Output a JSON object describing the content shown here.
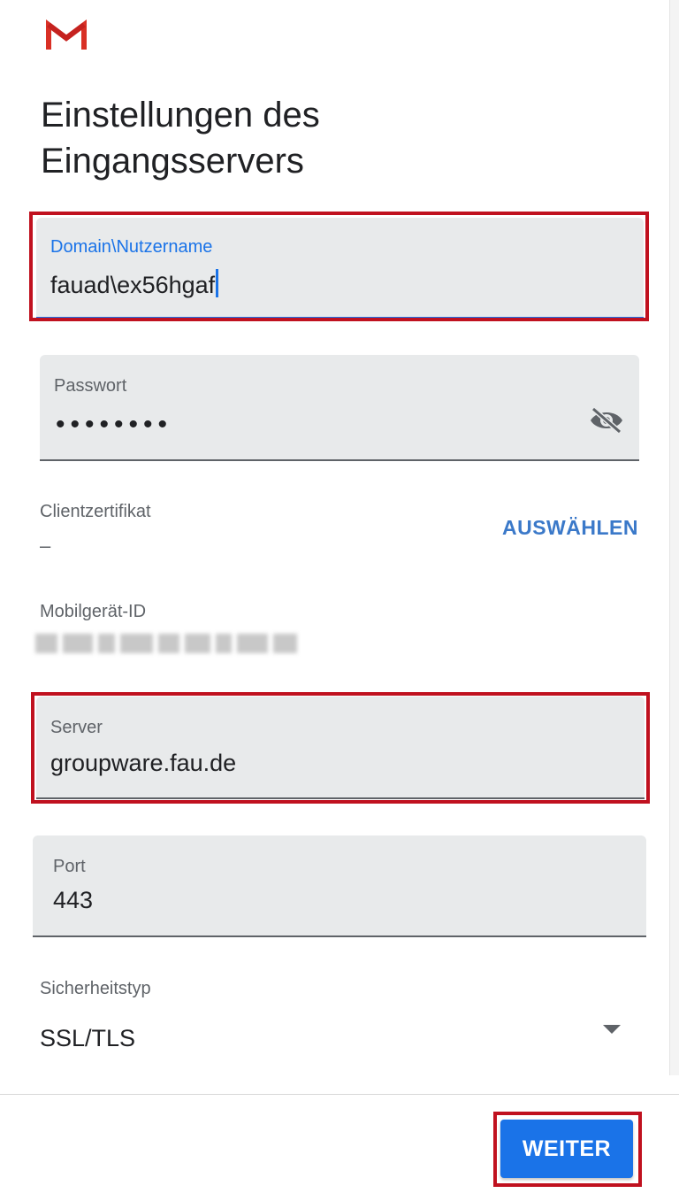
{
  "app": {
    "logo_icon": "gmail-logo-icon",
    "title_line1": "Einstellungen des",
    "title_line2": "Eingangsservers"
  },
  "fields": {
    "username": {
      "label": "Domain\\Nutzername",
      "value": "fauad\\ex56hgaf",
      "focused": true
    },
    "password": {
      "label": "Passwort",
      "masked_value": "••••••••",
      "toggle_icon": "visibility-off-icon"
    },
    "client_certificate": {
      "label": "Clientzertifikat",
      "value": "–",
      "action_label": "AUSWÄHLEN"
    },
    "device_id": {
      "label": "Mobilgerät-ID"
    },
    "server": {
      "label": "Server",
      "value": "groupware.fau.de"
    },
    "port": {
      "label": "Port",
      "value": "443"
    },
    "security_type": {
      "label": "Sicherheitstyp",
      "value": "SSL/TLS",
      "dropdown_icon": "dropdown-arrow-icon"
    }
  },
  "footer": {
    "next_label": "WEITER"
  },
  "colors": {
    "accent": "#1a73e8",
    "link": "#3b79c9",
    "annotation": "#c0111f",
    "field_bg": "#e8eaeb"
  }
}
